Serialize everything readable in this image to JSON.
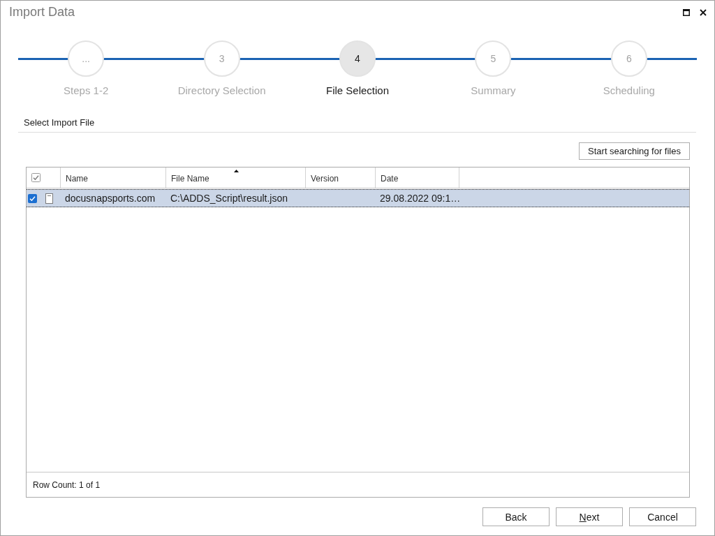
{
  "window": {
    "title": "Import Data"
  },
  "steps": [
    {
      "marker": "...",
      "label": "Steps 1-2",
      "selected": false
    },
    {
      "marker": "3",
      "label": "Directory Selection",
      "selected": false
    },
    {
      "marker": "4",
      "label": "File Selection",
      "selected": true
    },
    {
      "marker": "5",
      "label": "Summary",
      "selected": false
    },
    {
      "marker": "6",
      "label": "Scheduling",
      "selected": false
    }
  ],
  "section": {
    "title": "Select Import File"
  },
  "search_button": {
    "label": "Start searching for files"
  },
  "table": {
    "select_all": {
      "checked": true
    },
    "columns": [
      {
        "label": "Name",
        "sorted": false
      },
      {
        "label": "File Name",
        "sorted": true
      },
      {
        "label": "Version",
        "sorted": false
      },
      {
        "label": "Date",
        "sorted": false
      }
    ],
    "rows": [
      {
        "checked": true,
        "selected": true,
        "name": "docusnapsports.com",
        "file_name": "C:\\ADDS_Script\\result.json",
        "date": "29.08.2022 09:1…"
      }
    ],
    "footer": "Row Count: 1 of 1"
  },
  "buttons": [
    {
      "label": "Back",
      "access_key": false
    },
    {
      "label": "Next",
      "access_key": true
    },
    {
      "label": "Cancel",
      "access_key": false
    }
  ]
}
